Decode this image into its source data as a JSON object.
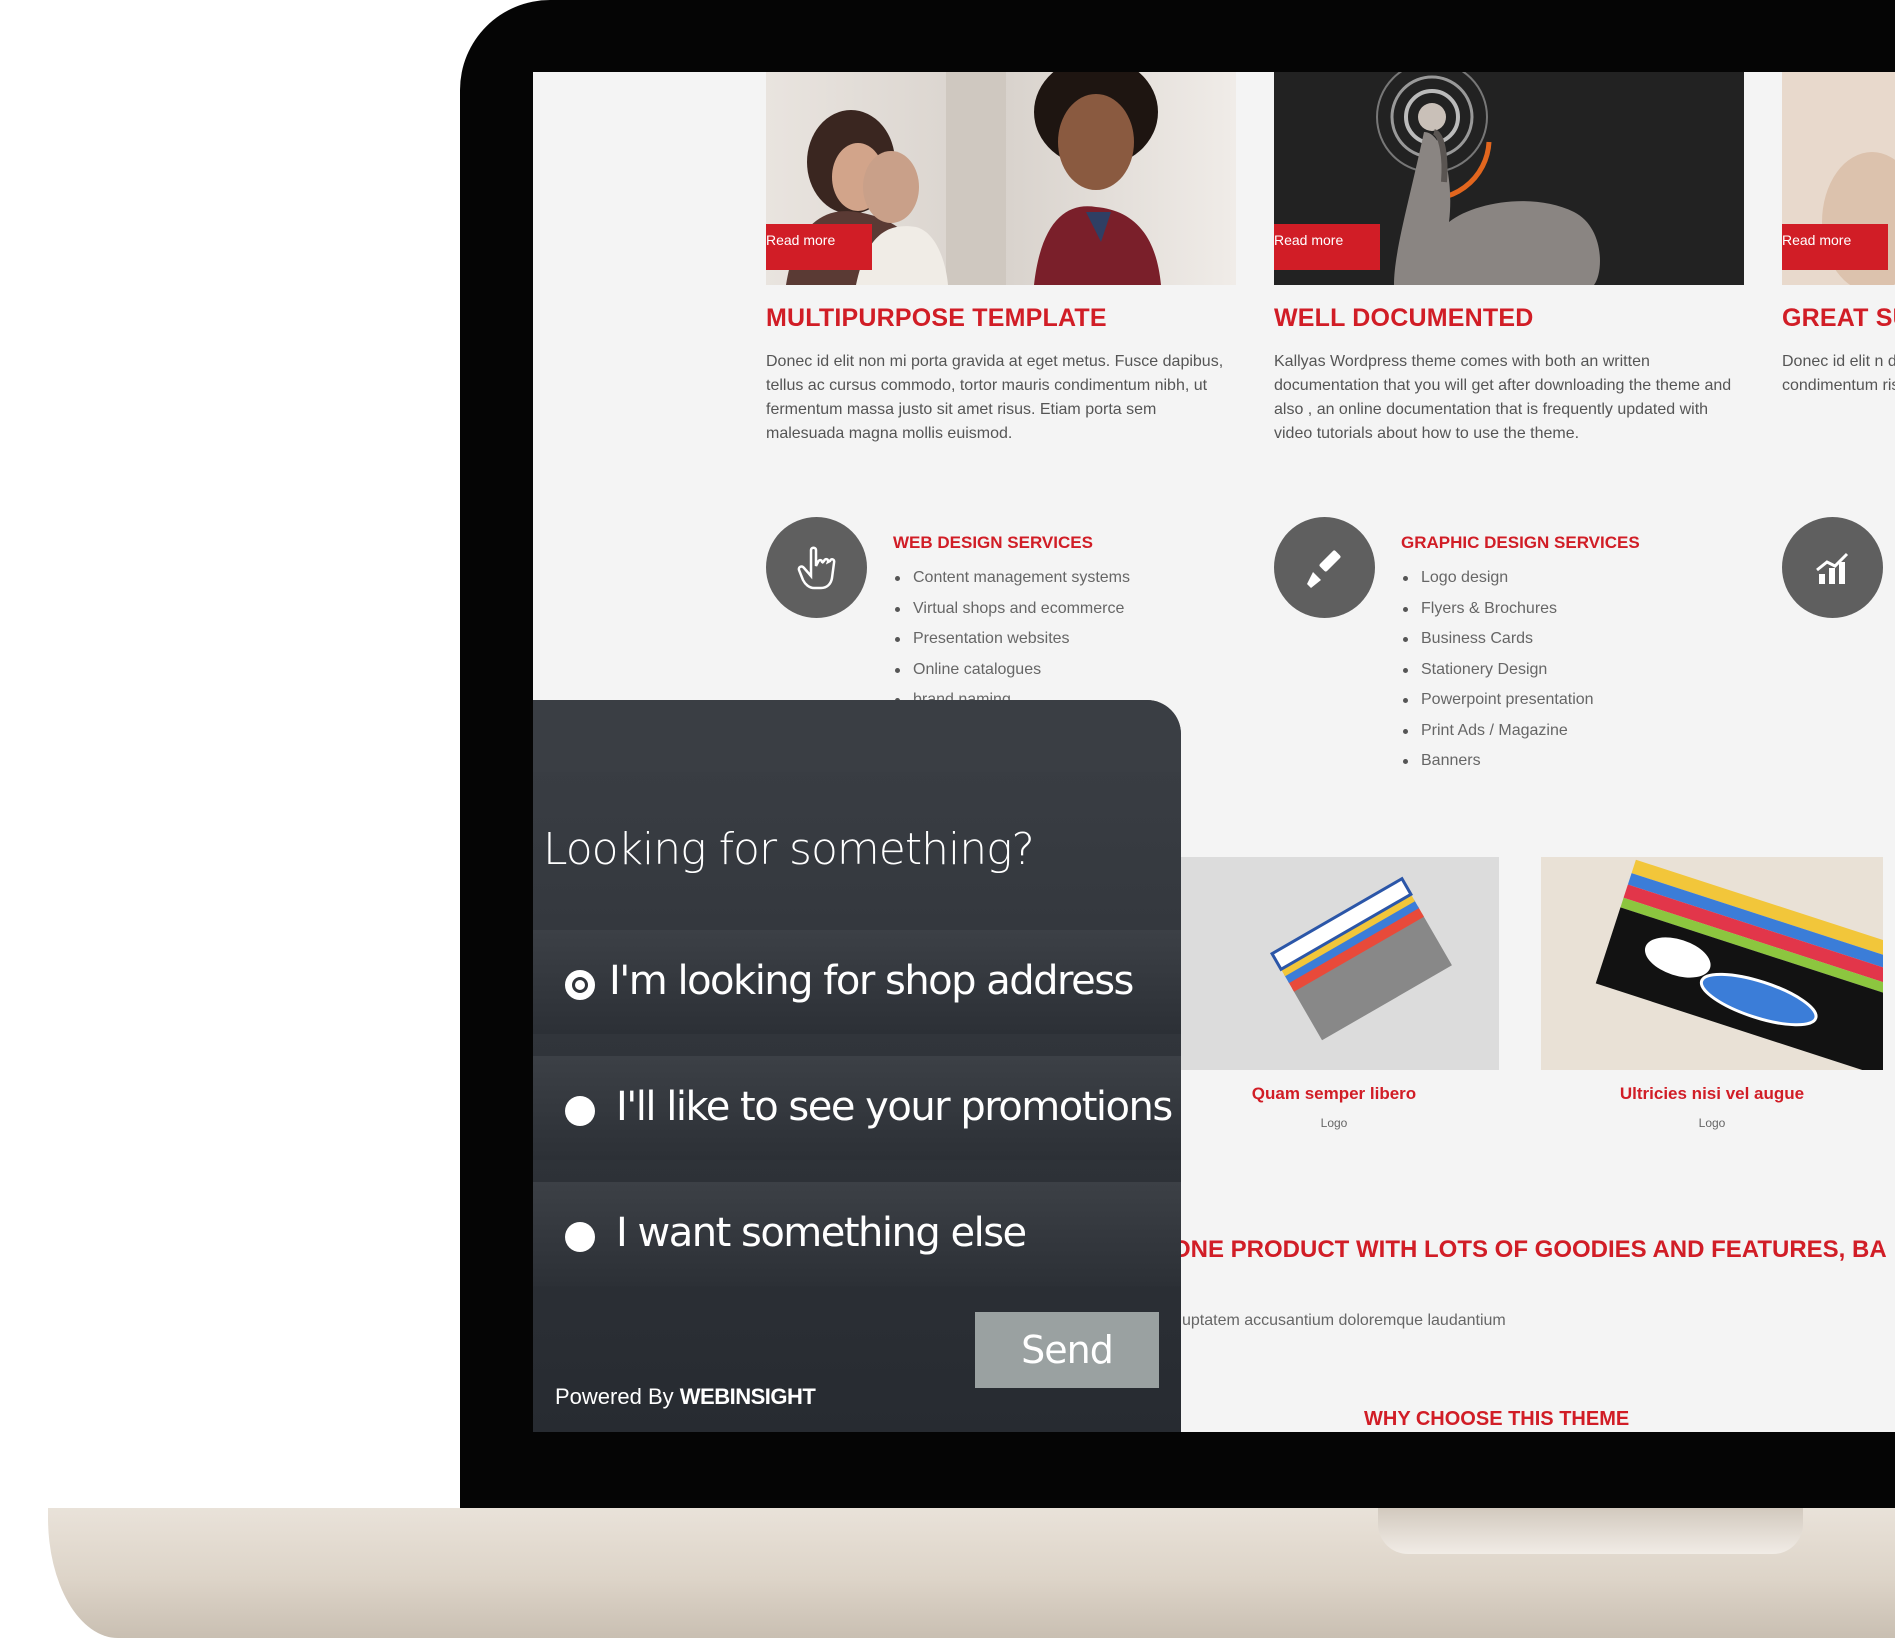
{
  "features": [
    {
      "read_more": "Read more",
      "title": "MULTIPURPOSE TEMPLATE",
      "text": "Donec id elit non mi porta gravida at eget metus. Fusce dapibus, tellus ac cursus commodo, tortor mauris condimentum nibh, ut fermentum massa justo sit amet risus. Etiam porta sem malesuada magna mollis euismod."
    },
    {
      "read_more": "Read more",
      "title": "WELL DOCUMENTED",
      "text": "Kallyas Wordpress theme comes with both an written documentation that you will get after downloading the theme and also , an online documentation that is frequently updated with video tutorials about how to use the theme."
    },
    {
      "read_more": "Read more",
      "title": "GREAT SU",
      "text": "Donec id elit n dapibus, tellus condimentum risus. Etiam po"
    }
  ],
  "services": [
    {
      "icon": "hand-pointer-icon",
      "title": "WEB DESIGN SERVICES",
      "items": [
        "Content management systems",
        "Virtual shops and ecommerce",
        "Presentation websites",
        "Online catalogues",
        "brand naming"
      ]
    },
    {
      "icon": "brush-icon",
      "title": "GRAPHIC DESIGN SERVICES",
      "items": [
        "Logo design",
        "Flyers & Brochures",
        "Business Cards",
        "Stationery Design",
        "Powerpoint presentation",
        "Print Ads / Magazine",
        "Banners"
      ]
    },
    {
      "icon": "chart-icon"
    }
  ],
  "portfolio": [
    {
      "title": "Quam semper libero",
      "subtitle": "Logo"
    },
    {
      "title": "Ultricies nisi vel augue",
      "subtitle": "Logo"
    }
  ],
  "headline": "ONE PRODUCT WITH LOTS OF GOODIES AND FEATURES, BA",
  "body_text": "uptatem accusantium doloremque laudantium",
  "why_title": "WHY CHOOSE THIS THEME",
  "widget": {
    "question": "Looking for something?",
    "options": [
      {
        "label": "I'm looking for shop address",
        "selected": true
      },
      {
        "label": "I'll like to see your promotions",
        "selected": false
      },
      {
        "label": "I want something else",
        "selected": false
      }
    ],
    "send_label": "Send",
    "powered_by": "Powered By",
    "brand": "WEBINSIGHT"
  },
  "colors": {
    "accent": "#d11d26",
    "widget_bg": "#2f3339",
    "send_bg": "#9aa1a1"
  }
}
